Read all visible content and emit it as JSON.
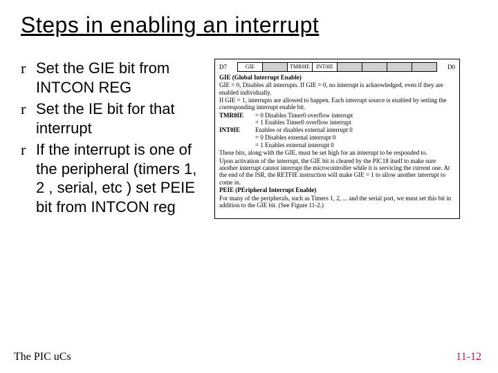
{
  "title": "Steps in enabling an interrupt",
  "bullets": [
    "Set the GIE bit from INTCON REG",
    "Set the IE bit for that interrupt",
    "If the interrupt is one of the peripheral (timers 1, 2 , serial, etc ) set PEIE bit from INTCON reg"
  ],
  "reg": {
    "left": "D7",
    "right": "D0",
    "cells": [
      "GIE",
      "",
      "TMR0IE",
      "INT0IE",
      "",
      "",
      "",
      ""
    ]
  },
  "desc": {
    "gie_title": "GIE (Global Interrupt Enable)",
    "gie0": "GIE = 0, Disables all interrupts. If GIE = 0, no interrupt is acknowledged, even if they are enabled individually.",
    "gie1": "If GIE = 1, interrupts are allowed to happen. Each interrupt source is enabled by setting the corresponding interrupt enable bit.",
    "tmr_label": "TMR0IE",
    "tmr_v1": "= 0 Disables Timer0 overflow interrupt",
    "tmr_v2": "= 1 Enables Timer0 overflow interrupt",
    "int_label": "INT0IE",
    "int_v0": "Enables or disables external interrupt 0",
    "int_v1": "= 0 Disables external interrupt 0",
    "int_v2": "= 1 Enables external interrupt 0",
    "note1": "These bits, along with the GIE, must be set high for an interrupt to be responded to.",
    "note2": "Upon activation of the interrupt, the GIE bit is cleared by the PIC18 itself to make sure another interrupt cannot interrupt the microcontroller while it is servicing the current one. At the end of the ISR, the RETFIE instruction will make GIE = 1 to allow another interrupt to come in.",
    "peie_title": "PEIE (PEripheral Interrupt Enable)",
    "peie_body": "For many of the peripherals, such as Timers 1, 2, ... and the serial port, we must set this bit in addition to the GIE bit. (See Figure 11-2.)"
  },
  "footer": {
    "left": "The PIC uCs",
    "right": "11-12"
  }
}
